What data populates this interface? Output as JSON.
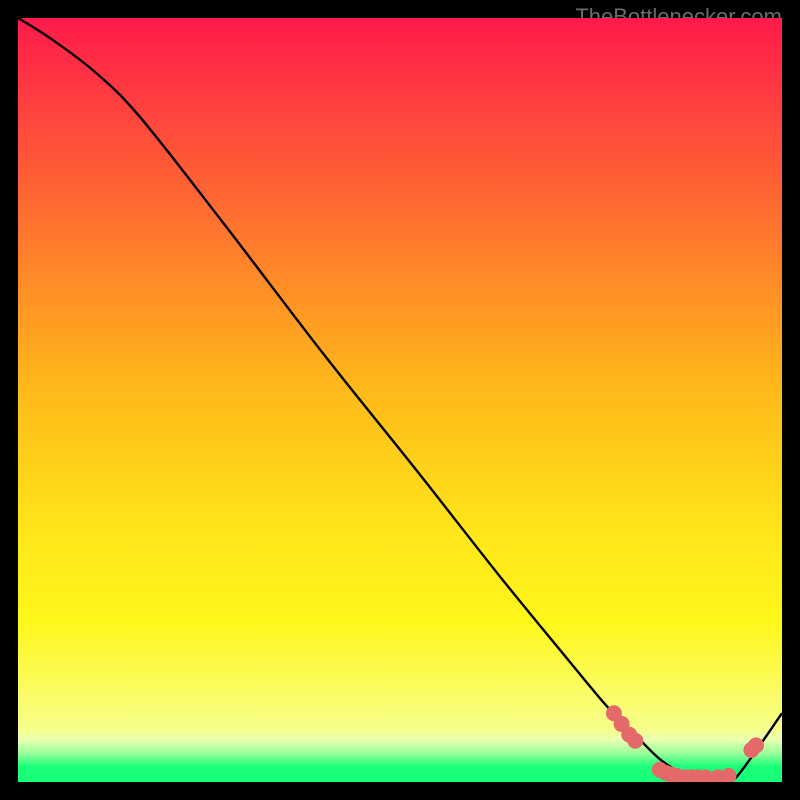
{
  "watermark": "TheBottlenecker.com",
  "chart_data": {
    "type": "line",
    "title": "",
    "xlabel": "",
    "ylabel": "",
    "xlim": [
      0,
      100
    ],
    "ylim": [
      0,
      100
    ],
    "gradient_stops": [
      {
        "pct": 0,
        "color": "#ff1a4a"
      },
      {
        "pct": 48,
        "color": "#ffb81a"
      },
      {
        "pct": 68,
        "color": "#ffe71a"
      },
      {
        "pct": 79,
        "color": "#fff71a"
      },
      {
        "pct": 93,
        "color": "#f7ff8a"
      },
      {
        "pct": 94.5,
        "color": "#e8ffb0"
      },
      {
        "pct": 96.2,
        "color": "#9aff9a"
      },
      {
        "pct": 98,
        "color": "#1aff7a"
      },
      {
        "pct": 100,
        "color": "#1aff7a"
      }
    ],
    "series": [
      {
        "name": "bottleneck-curve",
        "x": [
          0,
          4,
          10,
          16,
          27,
          40,
          52,
          63,
          72,
          77,
          80,
          84,
          87,
          90,
          92,
          94,
          100
        ],
        "y": [
          100,
          97.5,
          93,
          87,
          73,
          56,
          41,
          27,
          16,
          10,
          7,
          3,
          1.2,
          0.3,
          0.2,
          0.6,
          9
        ]
      }
    ],
    "markers": {
      "color": "#e46a6a",
      "radius_px": 8,
      "points": [
        {
          "x": 78,
          "y": 9.0
        },
        {
          "x": 79,
          "y": 7.6
        },
        {
          "x": 80,
          "y": 6.2
        },
        {
          "x": 80.8,
          "y": 5.4
        },
        {
          "x": 84.0,
          "y": 1.6
        },
        {
          "x": 84.8,
          "y": 1.2
        },
        {
          "x": 85.4,
          "y": 1.0
        },
        {
          "x": 86.2,
          "y": 0.8
        },
        {
          "x": 86.8,
          "y": 0.6
        },
        {
          "x": 87.4,
          "y": 0.6
        },
        {
          "x": 88.2,
          "y": 0.6
        },
        {
          "x": 89.0,
          "y": 0.6
        },
        {
          "x": 90.0,
          "y": 0.6
        },
        {
          "x": 91.6,
          "y": 0.6
        },
        {
          "x": 93.0,
          "y": 0.8
        },
        {
          "x": 96.0,
          "y": 4.2
        },
        {
          "x": 96.6,
          "y": 4.8
        }
      ]
    }
  }
}
